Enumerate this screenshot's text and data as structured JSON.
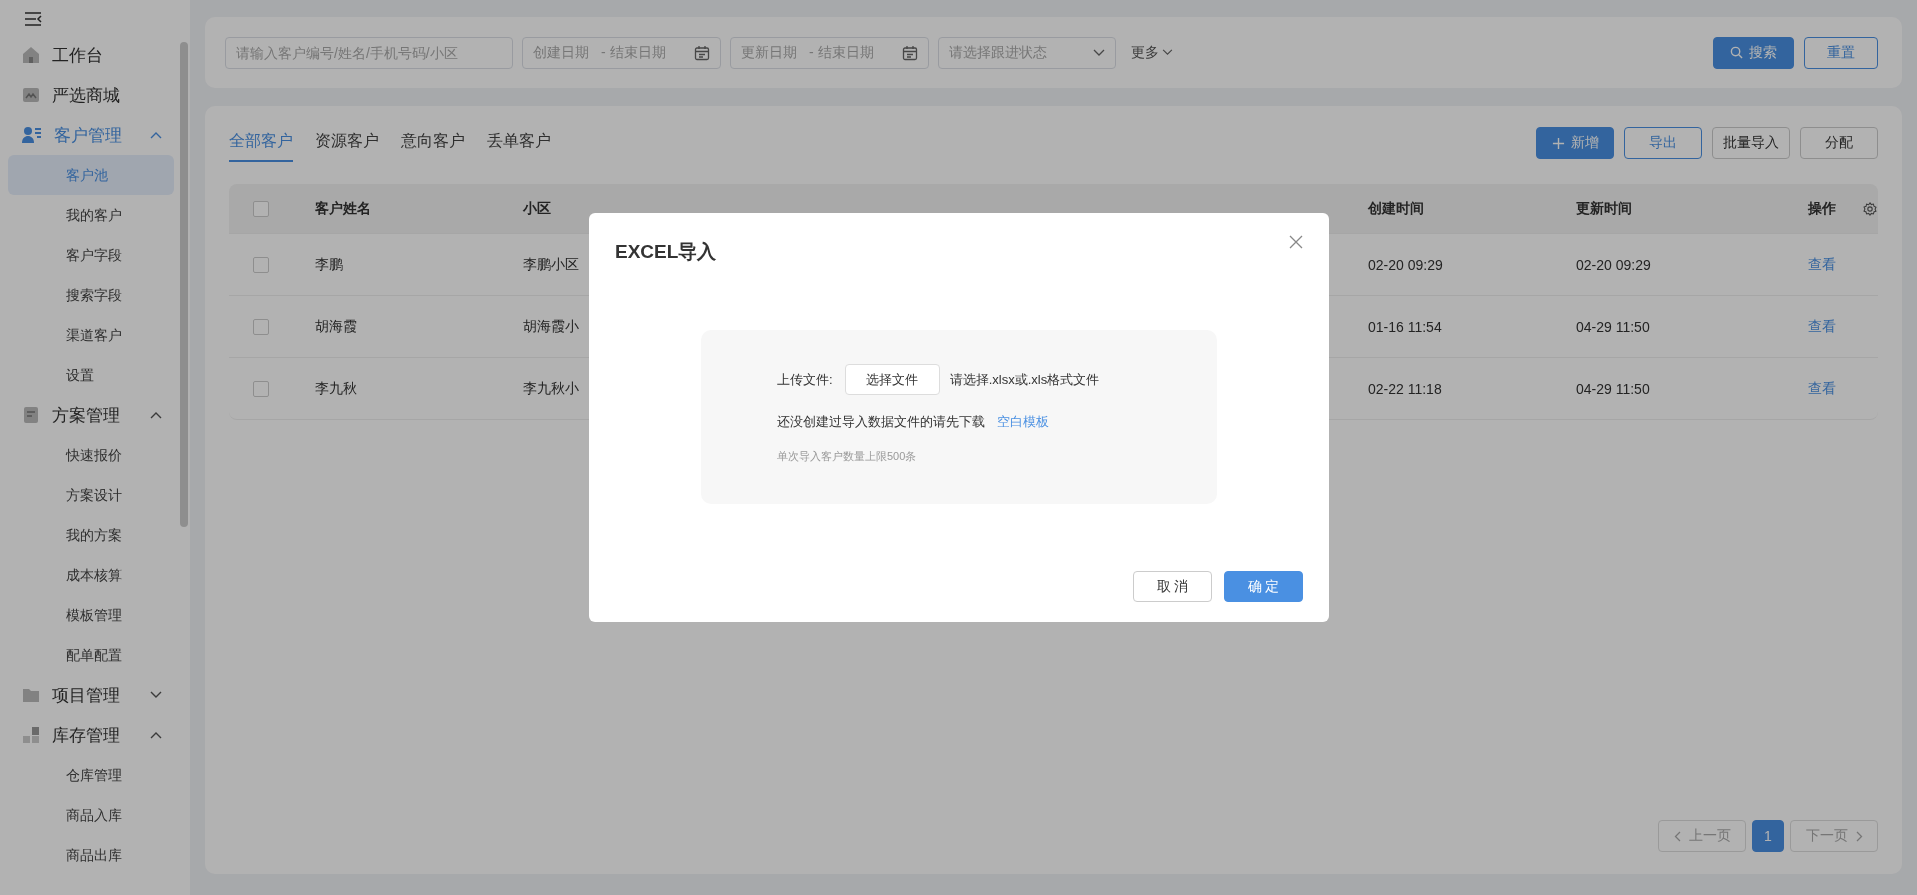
{
  "sidebar": {
    "items": [
      {
        "label": "工作台",
        "active": false
      },
      {
        "label": "严选商城",
        "active": false
      },
      {
        "label": "客户管理",
        "active": true,
        "expanded": true,
        "children": [
          {
            "label": "客户池",
            "selected": true
          },
          {
            "label": "我的客户",
            "selected": false
          },
          {
            "label": "客户字段",
            "selected": false
          },
          {
            "label": "搜索字段",
            "selected": false
          },
          {
            "label": "渠道客户",
            "selected": false
          },
          {
            "label": "设置",
            "selected": false
          }
        ]
      },
      {
        "label": "方案管理",
        "active": false,
        "expanded": true,
        "children": [
          {
            "label": "快速报价",
            "selected": false
          },
          {
            "label": "方案设计",
            "selected": false
          },
          {
            "label": "我的方案",
            "selected": false
          },
          {
            "label": "成本核算",
            "selected": false
          },
          {
            "label": "模板管理",
            "selected": false
          },
          {
            "label": "配单配置",
            "selected": false
          }
        ]
      },
      {
        "label": "项目管理",
        "active": false,
        "expanded": false
      },
      {
        "label": "库存管理",
        "active": false,
        "expanded": true,
        "children": [
          {
            "label": "仓库管理",
            "selected": false
          },
          {
            "label": "商品入库",
            "selected": false
          },
          {
            "label": "商品出库",
            "selected": false
          }
        ]
      }
    ]
  },
  "filters": {
    "search": {
      "placeholder": "请输入客户编号/姓名/手机号码/小区"
    },
    "create_date": {
      "start_placeholder": "创建日期",
      "end_placeholder": "- 结束日期"
    },
    "update_date": {
      "start_placeholder": "更新日期",
      "end_placeholder": "- 结束日期"
    },
    "status_select": {
      "placeholder": "请选择跟进状态"
    },
    "more": "更多",
    "search_button": "搜索",
    "reset_button": "重置"
  },
  "tabs": [
    {
      "label": "全部客户",
      "selected": true
    },
    {
      "label": "资源客户",
      "selected": false
    },
    {
      "label": "意向客户",
      "selected": false
    },
    {
      "label": "丢单客户",
      "selected": false
    }
  ],
  "actions": [
    {
      "label": "新增",
      "kind": "primary"
    },
    {
      "label": "导出",
      "kind": "outline"
    },
    {
      "label": "批量导入",
      "kind": "default"
    },
    {
      "label": "分配",
      "kind": "default"
    }
  ],
  "table": {
    "select_all_checked": false,
    "columns": [
      "客户姓名",
      "小区",
      "创建时间",
      "更新时间",
      "操作"
    ],
    "rows": [
      {
        "checked": false,
        "cells": [
          "李鹏",
          "李鹏小区",
          "02-20 09:29",
          "02-20 09:29",
          "查看"
        ]
      },
      {
        "checked": false,
        "cells": [
          "胡海霞",
          "胡海霞小",
          "01-16 11:54",
          "04-29 11:50",
          "查看"
        ]
      },
      {
        "checked": false,
        "cells": [
          "李九秋",
          "李九秋小",
          "02-22 11:18",
          "04-29 11:50",
          "查看"
        ]
      }
    ]
  },
  "pagination": {
    "prev": {
      "label": "上一页",
      "disabled": true
    },
    "pages": [
      {
        "label": "1",
        "selected": true
      }
    ],
    "next": {
      "label": "下一页",
      "disabled": true
    }
  },
  "dialog": {
    "title": "EXCEL导入",
    "upload_label": "上传文件:",
    "choose_button": "选择文件",
    "upload_hint": "请选择.xlsx或.xls格式文件",
    "template_text": "还没创建过导入数据文件的请先下载",
    "template_link": "空白模板",
    "limit_note": "单次导入客户数量上限500条",
    "cancel": "取 消",
    "confirm": "确 定"
  }
}
